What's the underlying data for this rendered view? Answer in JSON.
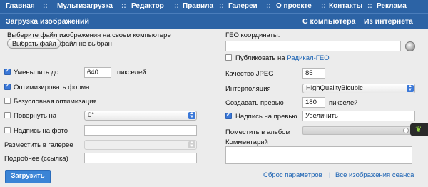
{
  "nav": {
    "items": [
      "Главная",
      "Мультизагрузка",
      "Редактор",
      "Правила",
      "Галереи",
      "О проекте",
      "Контакты",
      "Реклама"
    ],
    "sep": "::"
  },
  "tabs": {
    "title": "Загрузка изображений",
    "from_computer": "С компьютера",
    "from_internet": "Из интернета"
  },
  "left": {
    "choose_file_label": "Выберите файл изображения на своем компьютере",
    "choose_button": "Выбрать файл",
    "no_file": "файл не выбран",
    "reduce_label": "Уменьшить до",
    "reduce_value": "640",
    "reduce_unit": "пикселей",
    "optimize_label": "Оптимизировать формат",
    "unconditional_label": "Безусловная оптимизация",
    "rotate_label": "Повернуть на",
    "rotate_value": "0°",
    "caption_label": "Надпись на фото",
    "caption_value": "",
    "gallery_label": "Разместить в галерее",
    "gallery_value": "",
    "more_label": "Подробнее (ссылка)",
    "more_value": "",
    "submit": "Загрузить"
  },
  "right": {
    "geo_label": "ГЕО координаты:",
    "geo_value": "",
    "publish_prefix": "Публиковать на",
    "publish_link": "Радикал-ГЕО",
    "jpeg_label": "Качество JPEG",
    "jpeg_value": "85",
    "interp_label": "Интерполяция",
    "interp_value": "HighQualityBicubic",
    "preview_label": "Создавать превью",
    "preview_value": "180",
    "preview_unit": "пикселей",
    "preview_caption_label": "Надпись на превью",
    "preview_caption_value": "Увеличить",
    "album_label": "Поместить в альбом",
    "comment_label": "Комментарий",
    "comment_value": "",
    "reset_link": "Сброс параметров",
    "link_sep": "|",
    "all_images_link": "Все изображения сеанса"
  },
  "colors": {
    "nav_bg": "#2c63a5",
    "link": "#1a62b3",
    "submit_bg": "#3a84d6"
  }
}
